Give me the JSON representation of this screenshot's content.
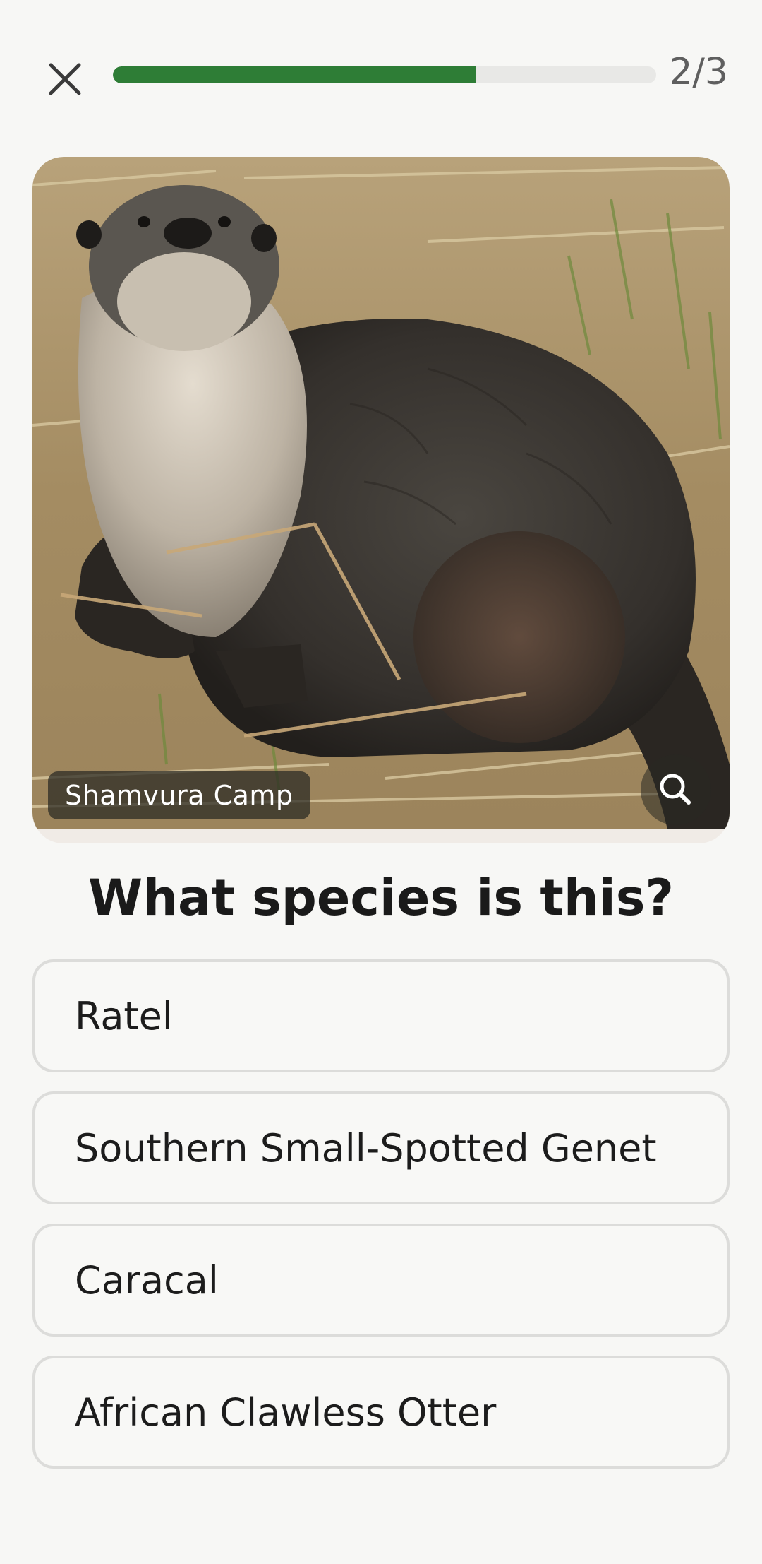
{
  "header": {
    "close_icon": "close-icon",
    "progress": {
      "current": 2,
      "total": 3,
      "fraction": 0.667,
      "label": "2/3"
    },
    "colors": {
      "progress_fill": "#2e7d36",
      "progress_track": "#e8e8e6"
    }
  },
  "photo": {
    "subject": "otter photo",
    "location_label": "Shamvura Camp",
    "zoom_icon": "zoom-icon"
  },
  "question": {
    "text": "What species is this?"
  },
  "options": [
    {
      "label": "Ratel"
    },
    {
      "label": "Southern Small-Spotted Genet"
    },
    {
      "label": "Caracal"
    },
    {
      "label": "African Clawless Otter"
    }
  ]
}
